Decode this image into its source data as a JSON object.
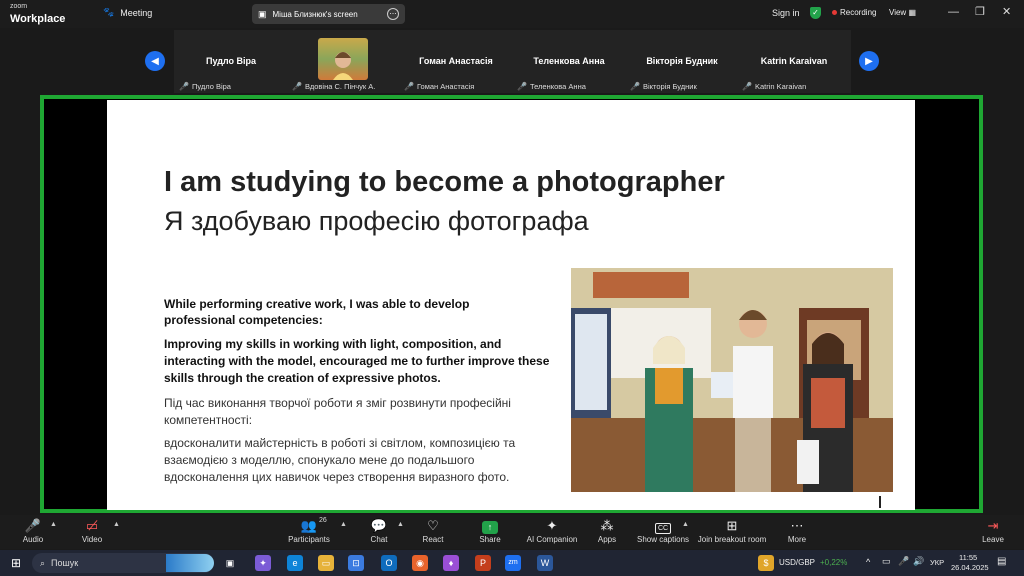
{
  "app": {
    "brand_small": "zoom",
    "brand_large": "Workplace",
    "meeting_label": "Meeting"
  },
  "share_pill": {
    "label": "Міша Близнюк's screen",
    "more": "⋯"
  },
  "topbar": {
    "sign_in": "Sign in",
    "recording": "Recording",
    "view": "View",
    "minimize": "—",
    "restore": "❐",
    "close": "✕"
  },
  "participants": [
    {
      "big": "Пудло Віра",
      "small": "Пудло Віра"
    },
    {
      "big": "",
      "small": "Вдовіна С. Пінчук А."
    },
    {
      "big": "Гоман Анастасія",
      "small": "Гоман Анастасія"
    },
    {
      "big": "Теленкова Анна",
      "small": "Теленкова Анна"
    },
    {
      "big": "Вікторія Будник",
      "small": "Вікторія Будник"
    },
    {
      "big": "Katrin Karaivan",
      "small": "Katrin Karaivan"
    }
  ],
  "slide": {
    "title": "I am studying to become a photographer",
    "subtitle": "Я здобуваю професію фотографа",
    "p_en_1": "While performing creative work, I was able to develop professional competencies:",
    "p_en_2": "Improving my skills in working with light, composition, and interacting with the model, encouraged me to further improve these skills through the creation of expressive photos.",
    "p_uk_1": "Під час виконання творчої роботи я зміг розвинути професійні компетентності:",
    "p_uk_2": "вдосконалити майстерність в роботі зі світлом, композицією та взаємодією з моделлю, спонукало мене до подальшого вдосконалення цих навичок через створення виразного фото."
  },
  "toolbar": {
    "audio": "Audio",
    "video": "Video",
    "participants": "Participants",
    "participants_count": "26",
    "chat": "Chat",
    "react": "React",
    "share": "Share",
    "ai_companion": "AI Companion",
    "apps": "Apps",
    "captions": "Show captions",
    "breakout": "Join breakout room",
    "more": "More",
    "leave": "Leave"
  },
  "taskbar": {
    "search": "Пошук",
    "ticker": "USD/GBP",
    "change": "+0,22%",
    "lang": "УКР",
    "time": "11:55",
    "date": "26.04.2025"
  },
  "colors": {
    "accent": "#1e6ff0",
    "share_border": "#1fa733",
    "recording": "#e53935",
    "positive": "#4caf50"
  }
}
